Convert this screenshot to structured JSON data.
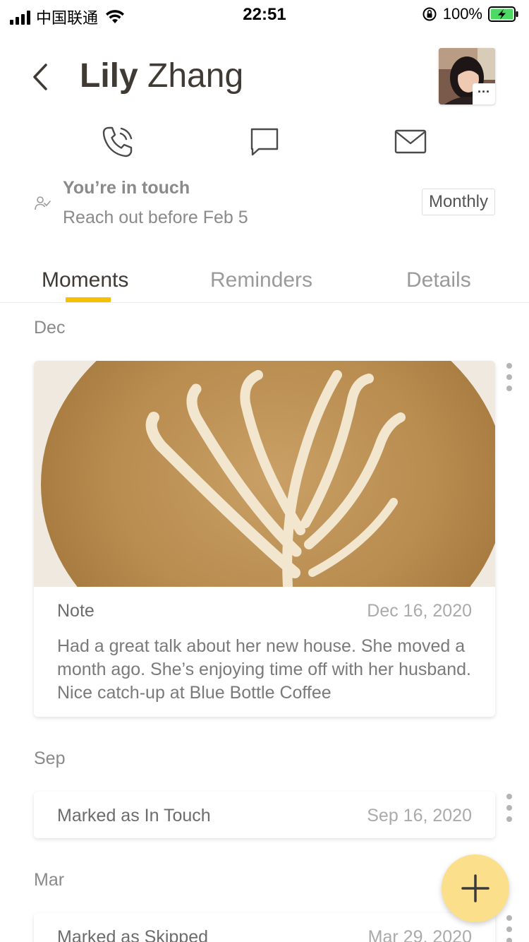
{
  "status_bar": {
    "carrier": "中国联通",
    "time": "22:51",
    "battery": "100%"
  },
  "contact": {
    "first_name": "Lily",
    "last_name": "Zhang",
    "avatar_more": "···"
  },
  "actions": [
    "phone-icon",
    "message-icon",
    "mail-icon"
  ],
  "touch_status": {
    "title": "You’re in touch",
    "subtitle": "Reach out before Feb 5",
    "frequency": "Monthly"
  },
  "tabs": [
    {
      "label": "Moments",
      "active": true
    },
    {
      "label": "Reminders",
      "active": false
    },
    {
      "label": "Details",
      "active": false
    }
  ],
  "moments": [
    {
      "month": "Dec",
      "type": "Note",
      "date": "Dec 16, 2020",
      "note": "Had a great talk about her new house. She moved a month ago. She’s enjoying time off with her husband. Nice catch-up at Blue Bottle Coffee",
      "has_photo": true
    },
    {
      "month": "Sep",
      "type": "Marked as In Touch",
      "date": "Sep 16, 2020"
    },
    {
      "month": "Mar",
      "type": "Marked as Skipped",
      "date": "Mar 29, 2020"
    }
  ],
  "colors": {
    "accent": "#f6c000",
    "fab": "#fbdf8b",
    "title": "#3f3a33",
    "muted": "#8a8a8a"
  }
}
